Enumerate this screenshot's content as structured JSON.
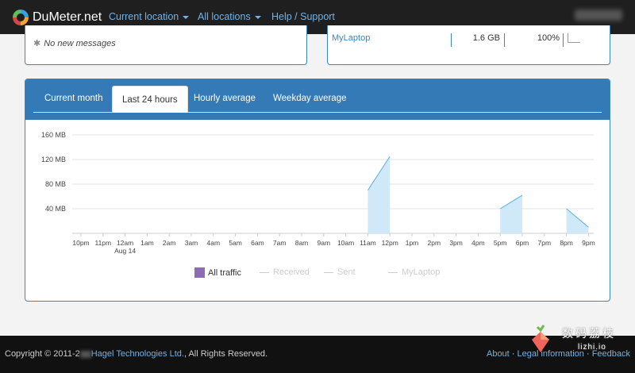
{
  "brand": {
    "name": "DuMeter.net"
  },
  "nav": {
    "current_location": "Current location",
    "all_locations": "All locations",
    "help": "Help / Support"
  },
  "messages": {
    "text": "No new messages"
  },
  "device": {
    "name": "MyLaptop",
    "size": "1.6 GB",
    "percent": "100%"
  },
  "tabs": [
    "Current month",
    "Last 24 hours",
    "Hourly average",
    "Weekday average"
  ],
  "active_tab": "Last 24 hours",
  "chart_data": {
    "type": "area",
    "unit": "MB",
    "ylim": [
      0,
      160
    ],
    "yticks": [
      40,
      80,
      120,
      160
    ],
    "ytick_labels": [
      "40 MB",
      "80 MB",
      "120 MB",
      "160 MB"
    ],
    "x_labels": [
      "10pm",
      "11pm",
      "12am",
      "1am",
      "2am",
      "3am",
      "4am",
      "5am",
      "6am",
      "7am",
      "8am",
      "9am",
      "10am",
      "11am",
      "12pm",
      "1pm",
      "2pm",
      "3pm",
      "4pm",
      "5pm",
      "6pm",
      "7pm",
      "8pm",
      "9pm"
    ],
    "date_label": "Aug 14",
    "segments": [
      {
        "series": "All traffic",
        "points": [
          [
            13,
            70
          ],
          [
            14,
            125
          ]
        ]
      },
      {
        "series": "All traffic",
        "points": [
          [
            19,
            40
          ],
          [
            20,
            62
          ]
        ]
      },
      {
        "series": "All traffic",
        "points": [
          [
            22,
            40
          ],
          [
            23,
            10
          ]
        ]
      }
    ],
    "grid": true,
    "legend": [
      "All traffic",
      "Received",
      "Sent",
      "MyLaptop"
    ],
    "legend_position": "bottom"
  },
  "footer": {
    "copyright_prefix": "Copyright © 2011-2",
    "company": "Hagel Technologies Ltd.",
    "rights": ", All Rights Reserved.",
    "about": "About",
    "legal": "Legal information",
    "feedback": "Feedback",
    "sep": " · "
  },
  "watermark": {
    "cn": "数码荔枝",
    "en": "lizhi.io"
  },
  "colors": {
    "accent": "#337ab7",
    "link": "#6fb3e8",
    "area_fill": "#cfe9f8",
    "area_line": "#5aaee0",
    "legend_all": "#8c6db0"
  }
}
